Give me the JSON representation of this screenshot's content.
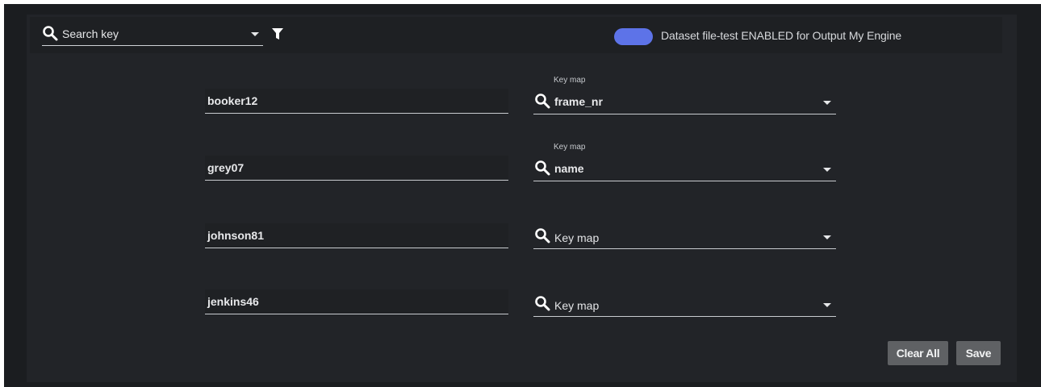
{
  "search": {
    "placeholder": "Search key"
  },
  "toggle": {
    "enabled": true,
    "label": "Dataset file-test ENABLED for Output My Engine",
    "color": "#5d73e8"
  },
  "mappings": [
    {
      "key": "booker12",
      "label": "Key map",
      "value": "frame_nr",
      "placeholder": ""
    },
    {
      "key": "grey07",
      "label": "Key map",
      "value": "name",
      "placeholder": ""
    },
    {
      "key": "johnson81",
      "label": "",
      "value": "",
      "placeholder": "Key map"
    },
    {
      "key": "jenkins46",
      "label": "",
      "value": "",
      "placeholder": "Key map"
    }
  ],
  "buttons": {
    "clear_all": "Clear All",
    "save": "Save"
  },
  "icons": {
    "search": "search-icon",
    "filter": "filter-icon",
    "dropdown": "chevron-down-icon"
  }
}
